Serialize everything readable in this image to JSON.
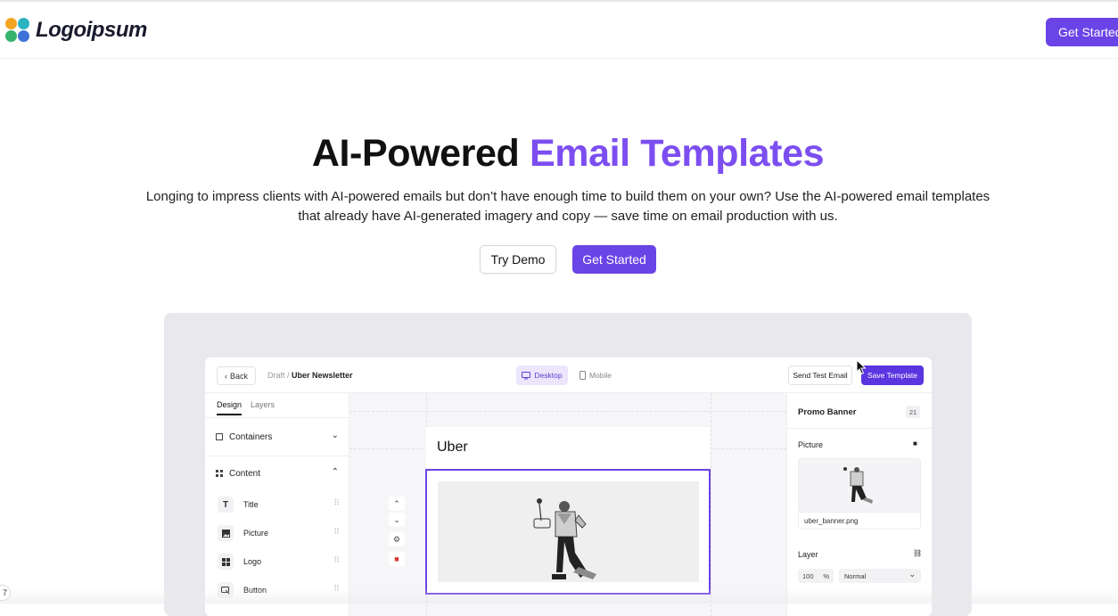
{
  "nav": {
    "logo_text": "Logoipsum",
    "cta_label": "Get Started"
  },
  "hero": {
    "title_main": "AI-Powered",
    "title_accent": "Email Templates",
    "subtitle_line1": "Longing to impress clients with AI-powered emails but don’t have enough time to build them on your own? Use the AI-powered email templates",
    "subtitle_line2": "that already have AI-generated imagery and copy — save time on email production with us.",
    "demo_label": "Try Demo",
    "start_label": "Get Started"
  },
  "editor": {
    "back_label": "Back",
    "crumb_parent": "Draft /",
    "crumb_current": "Uber Newsletter",
    "view_desktop": "Desktop",
    "view_mobile": "Mobile",
    "send_test_label": "Send Test Email",
    "save_label": "Save Template",
    "tabs": {
      "design": "Design",
      "layers": "Layers"
    },
    "sections": {
      "containers": "Containers",
      "content": "Content"
    },
    "content_items": [
      {
        "label": "Title",
        "icon": "text-icon"
      },
      {
        "label": "Picture",
        "icon": "image-icon"
      },
      {
        "label": "Logo",
        "icon": "grid-icon"
      },
      {
        "label": "Button",
        "icon": "button-icon"
      }
    ],
    "email_brand": "Uber",
    "right_panel": {
      "block_title": "Promo Banner",
      "block_count": "21",
      "picture_label": "Picture",
      "file_name": "uber_banner.png",
      "layer_label": "Layer",
      "opacity_value": "100",
      "opacity_unit": "%",
      "blend_mode": "Normal"
    }
  },
  "misc": {
    "corner_number": "7"
  },
  "colors": {
    "accent": "#7c4ef0",
    "button": "#6a44e6"
  }
}
